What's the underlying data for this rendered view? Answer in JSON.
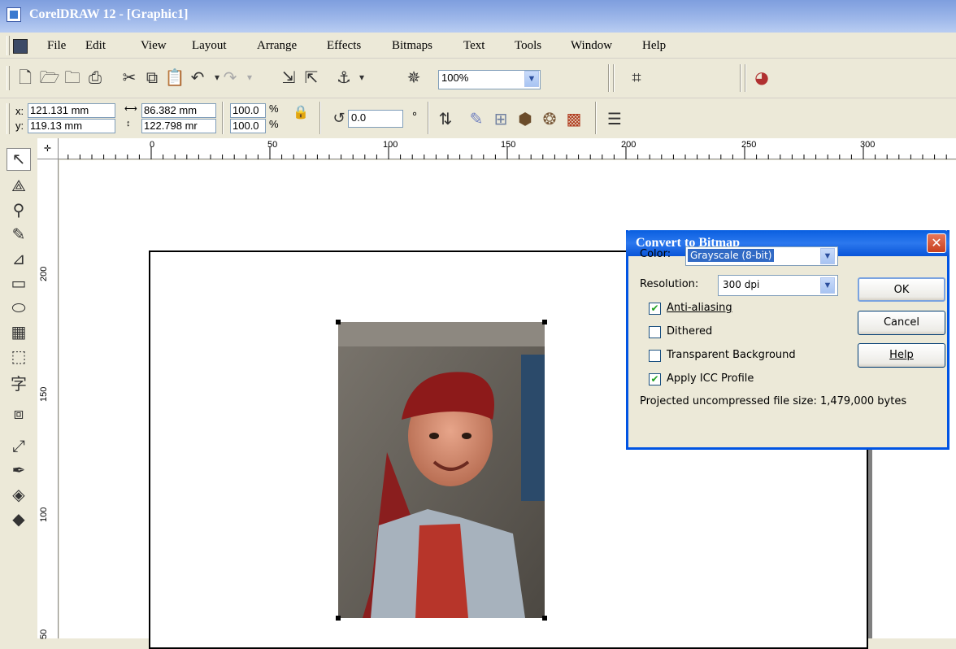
{
  "window": {
    "title": "CorelDRAW 12 - [Graphic1]"
  },
  "menu": [
    "File",
    "Edit",
    "View",
    "Layout",
    "Arrange",
    "Effects",
    "Bitmaps",
    "Text",
    "Tools",
    "Window",
    "Help"
  ],
  "toolbar": {
    "zoom_value": "100%",
    "icons": [
      "new-icon",
      "open-icon",
      "save-icon",
      "print-icon",
      "cut-icon",
      "copy-icon",
      "paste-icon",
      "undo-icon",
      "redo-icon",
      "import-icon",
      "export-icon",
      "application-launcher-icon",
      "corel-online-icon",
      "zoom-levels-icon",
      "color-management-icon"
    ]
  },
  "property_bar": {
    "x": "121.131 mm",
    "y": "119.13 mm",
    "width": "86.382 mm",
    "height": "122.798 mr",
    "scale_x": "100.0",
    "scale_y": "100.0",
    "percent": "%",
    "rotation": "0.0",
    "degree": "°",
    "x_label": "x:",
    "y_label": "y:"
  },
  "ruler": {
    "h_labels": [
      "0",
      "50",
      "100",
      "150",
      "200",
      "250",
      "300"
    ],
    "v_labels": [
      "200",
      "150",
      "100",
      "50"
    ]
  },
  "toolbox": [
    "pick-tool-icon",
    "shape-tool-icon",
    "zoom-tool-icon",
    "freehand-tool-icon",
    "smart-fill-icon",
    "rectangle-tool-icon",
    "ellipse-tool-icon",
    "polygon-tool-icon",
    "basic-shapes-icon",
    "text-tool-icon",
    "interactive-blend-icon",
    "eyedropper-icon",
    "outline-tool-icon",
    "fill-tool-icon",
    "interactive-fill-icon"
  ],
  "dialog": {
    "title": "Convert to Bitmap",
    "color_label": "Color:",
    "color_value": "Grayscale (8-bit)",
    "resolution_label": "Resolution:",
    "resolution_value": "300 dpi",
    "anti_aliasing": {
      "label": "Anti-aliasing",
      "checked": true
    },
    "dithered": {
      "label": "Dithered",
      "checked": false
    },
    "transparent_background": {
      "label": "Transparent Background",
      "checked": false
    },
    "apply_icc": {
      "label": "Apply ICC Profile",
      "checked": true
    },
    "file_size": "Projected uncompressed file size: 1,479,000 bytes",
    "ok": "OK",
    "cancel": "Cancel",
    "help": "Help"
  }
}
